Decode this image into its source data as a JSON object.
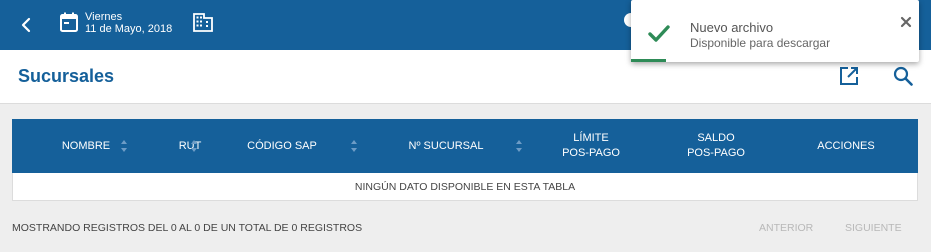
{
  "colors": {
    "primary": "#15609a",
    "success": "#2e8b57",
    "muted": "#b8b8b8"
  },
  "topbar": {
    "back_icon": "chevron-left-icon",
    "calendar_icon": "calendar-icon",
    "day": "Viernes",
    "date": "11 de Mayo, 2018",
    "building_icon": "building-icon"
  },
  "header": {
    "title": "Sucursales",
    "open_icon": "open-in-new-icon",
    "search_icon": "search-icon"
  },
  "table": {
    "columns": [
      {
        "label": "NOMBRE",
        "sortable": true
      },
      {
        "label": "RUT",
        "sortable": true
      },
      {
        "label": "CÓDIGO SAP",
        "sortable": true
      },
      {
        "label": "Nº SUCURSAL",
        "sortable": true
      },
      {
        "label": "LÍMITE\nPOS-PAGO",
        "sortable": false
      },
      {
        "label": "SALDO\nPOS-PAGO",
        "sortable": false
      },
      {
        "label": "ACCIONES",
        "sortable": false
      }
    ],
    "empty_message": "NINGÚN DATO DISPONIBLE EN ESTA TABLA"
  },
  "footer": {
    "info": "MOSTRANDO REGISTROS DEL 0 AL 0 DE UN TOTAL DE 0 REGISTROS",
    "previous": "ANTERIOR",
    "next": "SIGUIENTE"
  },
  "toast": {
    "title": "Nuevo archivo",
    "message": "Disponible para descargar",
    "icon": "check-icon",
    "close_icon": "close-icon",
    "progress": 0.12
  }
}
